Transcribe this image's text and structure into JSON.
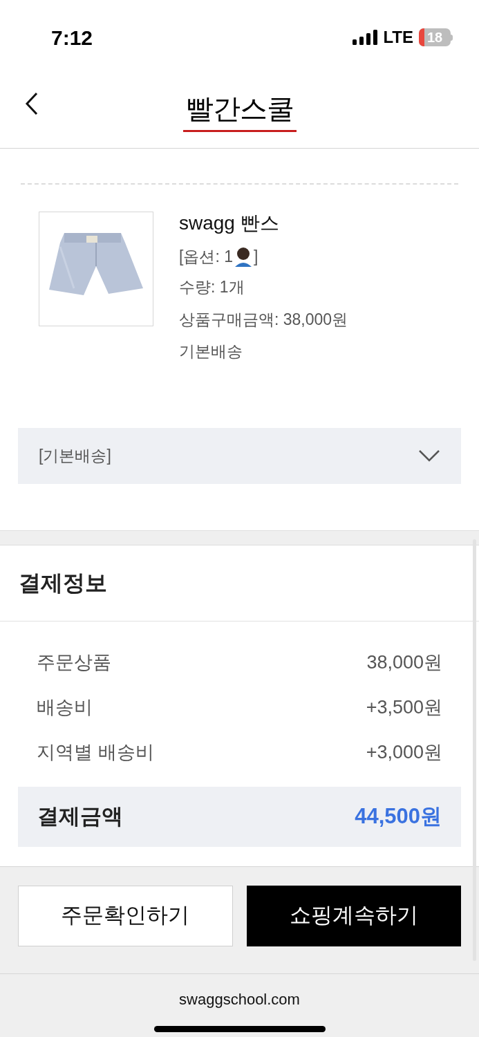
{
  "status_bar": {
    "time": "7:12",
    "network": "LTE",
    "battery": "18"
  },
  "header": {
    "logo": "빨간스쿨"
  },
  "product": {
    "name": "swagg 빤스",
    "option_prefix": "[옵션: 1",
    "option_suffix": "]",
    "quantity": "수량: 1개",
    "price": "상품구매금액: 38,000원",
    "shipping": "기본배송"
  },
  "shipping_select": {
    "value": "[기본배송]"
  },
  "payment": {
    "title": "결제정보",
    "rows": [
      {
        "label": "주문상품",
        "value": "38,000원"
      },
      {
        "label": "배송비",
        "value": "+3,500원"
      },
      {
        "label": "지역별 배송비",
        "value": "+3,000원"
      }
    ],
    "total": {
      "label": "결제금액",
      "value": "44,500원"
    }
  },
  "buttons": [
    {
      "label": "주문확인하기",
      "kind": "outline"
    },
    {
      "label": "쇼핑계속하기",
      "kind": "solid"
    }
  ],
  "browser": {
    "url": "swaggschool.com"
  }
}
